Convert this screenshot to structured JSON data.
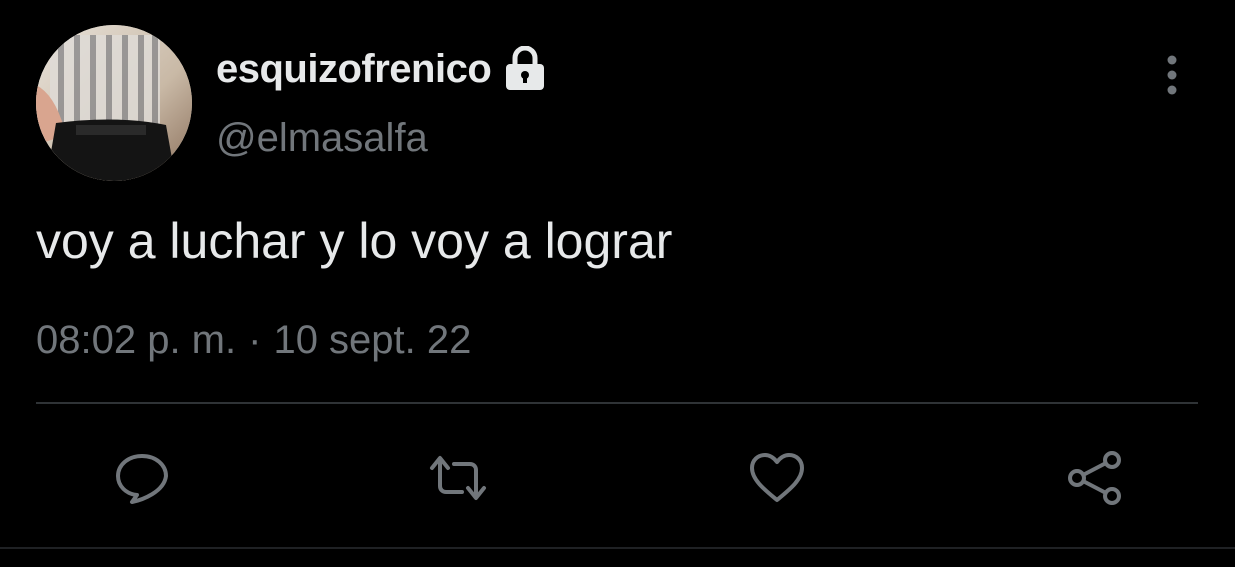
{
  "user": {
    "display_name": "esquizofrenico",
    "handle": "@elmasalfa",
    "protected_icon": "lock-icon",
    "avatar": "profile-photo"
  },
  "tweet": {
    "text": "voy a luchar y lo voy a lograr",
    "time": "08:02 p. m.",
    "separator": "·",
    "date": "10 sept. 22"
  },
  "actions": [
    {
      "name": "reply",
      "icon": "reply-icon"
    },
    {
      "name": "retweet",
      "icon": "retweet-icon"
    },
    {
      "name": "like",
      "icon": "heart-icon"
    },
    {
      "name": "share",
      "icon": "share-icon"
    }
  ],
  "colors": {
    "background": "#000000",
    "primary_text": "#e7e9ea",
    "secondary_text": "#71767b",
    "icon": "#71767b",
    "divider": "#2f3336"
  }
}
